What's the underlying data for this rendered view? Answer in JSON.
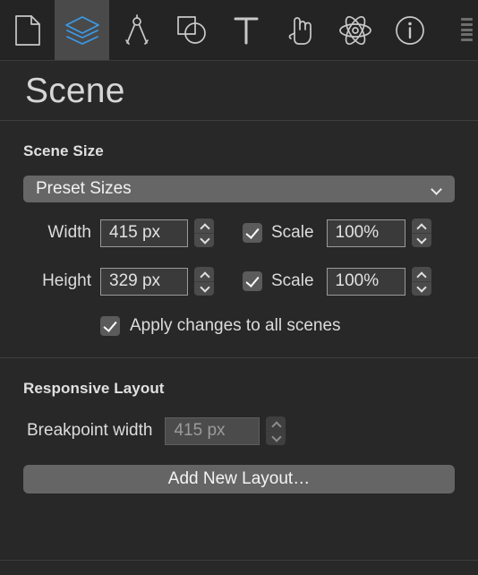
{
  "toolbar": {
    "items": [
      {
        "name": "document-icon",
        "label": "Document",
        "selected": false
      },
      {
        "name": "layers-icon",
        "label": "Scene",
        "selected": true
      },
      {
        "name": "compass-icon",
        "label": "Animation",
        "selected": false
      },
      {
        "name": "shapes-icon",
        "label": "Element",
        "selected": false
      },
      {
        "name": "text-icon",
        "label": "Text",
        "selected": false
      },
      {
        "name": "hand-icon",
        "label": "Actions",
        "selected": false
      },
      {
        "name": "atom-icon",
        "label": "Physics",
        "selected": false
      },
      {
        "name": "info-icon",
        "label": "Identity",
        "selected": false
      }
    ],
    "overflow_label": "More"
  },
  "header": {
    "title": "Scene"
  },
  "scene_size": {
    "section_title": "Scene Size",
    "preset": {
      "value": "Preset Sizes",
      "chevron": "chevron-down-icon"
    },
    "width": {
      "label": "Width",
      "value": "415 px",
      "scale_label": "Scale",
      "scale_checked": true,
      "scale_value": "100%"
    },
    "height": {
      "label": "Height",
      "value": "329 px",
      "scale_label": "Scale",
      "scale_checked": true,
      "scale_value": "100%"
    },
    "apply_all": {
      "label": "Apply changes to all scenes",
      "checked": true
    }
  },
  "responsive_layout": {
    "section_title": "Responsive Layout",
    "breakpoint": {
      "label": "Breakpoint width",
      "value": "415 px",
      "disabled": true
    },
    "add_layout_label": "Add New Layout…"
  },
  "colors": {
    "background": "#282828",
    "toolbar_background": "#242424",
    "selected_tab": "#4a4a4a",
    "accent": "#3b9ae8",
    "control_gray": "#666666",
    "text": "#d8d8d8"
  }
}
